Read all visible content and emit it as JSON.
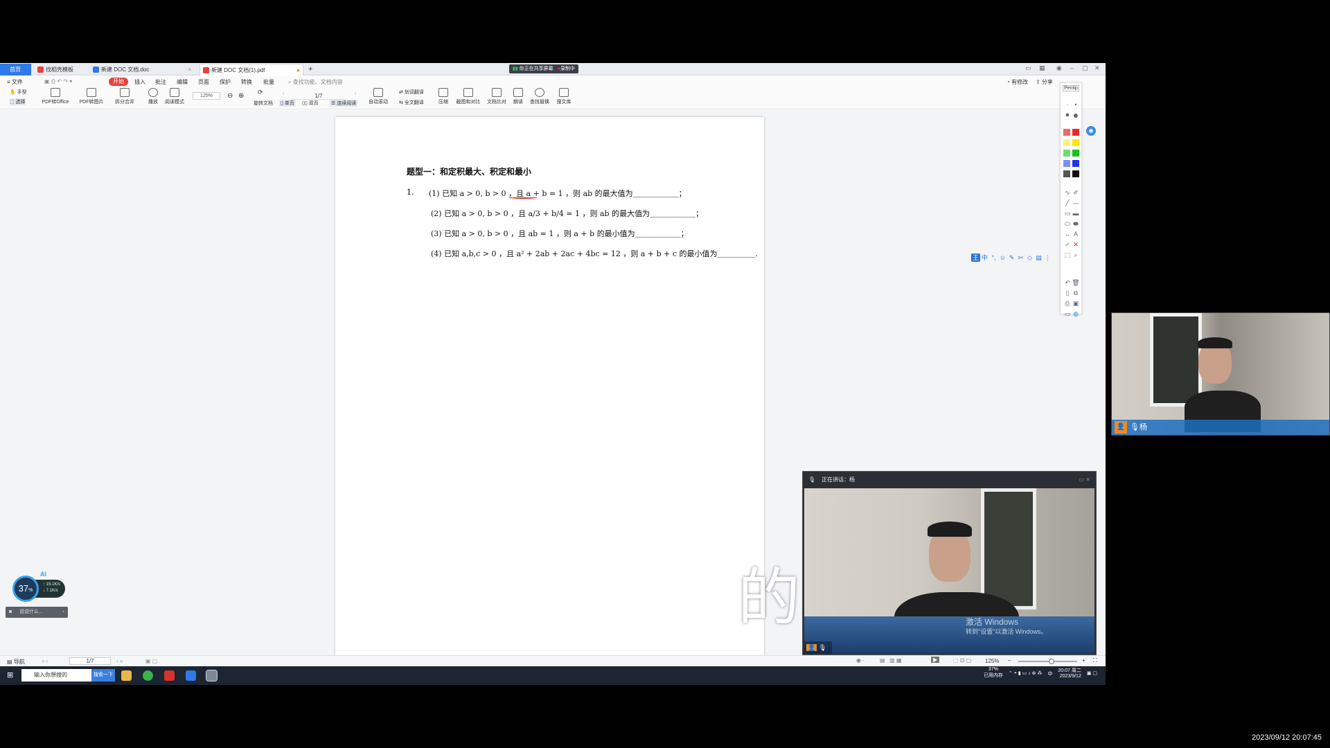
{
  "tabs": [
    {
      "label": "首页",
      "type": "home"
    },
    {
      "label": "找稻壳模板",
      "color": "#e2433c"
    },
    {
      "label": "新建 DOC 文档.doc",
      "color": "#2f79e8"
    },
    {
      "label": "新建 DOC 文档(1).pdf",
      "color": "#e2433c",
      "active": true
    }
  ],
  "tab_add": "+",
  "share_status": {
    "sharing": "你正在共享屏幕",
    "recording": "录制中"
  },
  "menu": [
    "≡ 文件",
    "开始",
    "插入",
    "批注",
    "编辑",
    "页面",
    "保护",
    "转换",
    "批量"
  ],
  "menu_search": "查找功能、文档内容",
  "menu_right": [
    "有修改",
    "分享"
  ],
  "toolbar": {
    "hand": "手型",
    "select": "选择",
    "tools": [
      "PDF转Office",
      "PDF转图片",
      "拆分合并",
      "播放",
      "阅读模式",
      "旋转文档",
      "单页",
      "双页",
      "连续阅读",
      "自动滚动",
      "划词翻译",
      "全文翻译",
      "压缩",
      "截图和对比",
      "文档比对",
      "朗读",
      "查找替换",
      "搜文库"
    ],
    "zoom": "125%",
    "page": "1/7"
  },
  "document": {
    "title": "题型一：和定积最大、积定和最小",
    "qnum": "1.",
    "questions": [
      "(1) 已知 a > 0, b > 0 ，且 a + b = 1 ，则 ab 的最大值为＿＿＿＿＿＿；",
      "(2) 已知 a > 0, b > 0 ，且 a/3 + b/4 = 1 ，则 ab 的最大值为＿＿＿＿＿＿；",
      "(3) 已知 a > 0, b > 0 ，且 ab = 1 ，则 a + b 的最小值为＿＿＿＿＿＿；",
      "(4) 已知 a,b,c > 0 ，且 a² + 2ab + 2ac + 4bc = 12 ，则 a + b + c 的最小值为＿＿＿＿＿."
    ]
  },
  "palette": {
    "header": "Pentip",
    "colors": [
      "#f06a6a",
      "#e82a2a",
      "#fff27a",
      "#ffe600",
      "#6fdc6f",
      "#19c219",
      "#7a8cff",
      "#2233e8",
      "#555555",
      "#111111"
    ]
  },
  "statusbar": {
    "nav": "导航",
    "page": "1/7",
    "zoom": "125%"
  },
  "taskbar": {
    "search_placeholder": "输入你想搜的",
    "search_button": "搜索一下",
    "tray_mem": "37%",
    "tray_mem_label": "已用内存",
    "lang": "中",
    "time": "20:07 周二",
    "date": "2023/9/12"
  },
  "ai_widget": {
    "label": "AI",
    "percent": "37",
    "up": "15.1K/s",
    "down": "7.1K/s",
    "chat": "说说什么..."
  },
  "speaker": {
    "header": "正在讲话：杨",
    "name": "杨"
  },
  "cam_name": "杨",
  "caption": "的最大值",
  "watermark": {
    "line1": "激活 Windows",
    "line2": "转到\"设置\"以激活 Windows。"
  },
  "rec_timestamp": "2023/09/12 20:07:45"
}
